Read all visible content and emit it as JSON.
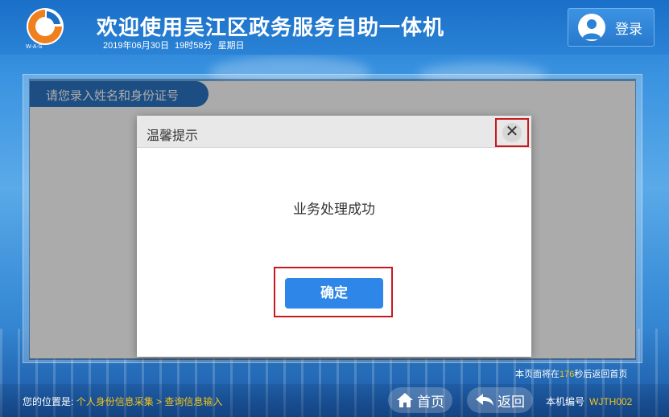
{
  "header": {
    "logo_text": "W-A-S",
    "title": "欢迎使用吴江区政务服务自助一体机",
    "date": "2019年06月30日",
    "time": "19时58分",
    "weekday": "星期日",
    "login_label": "登录",
    "login_icon": "user-avatar-icon"
  },
  "panel": {
    "tab_label": "请您录入姓名和身份证号"
  },
  "dialog": {
    "title": "温馨提示",
    "close_icon": "close-icon",
    "message": "业务处理成功",
    "confirm_label": "确定"
  },
  "footer": {
    "countdown_prefix": "本页面将在",
    "countdown_seconds": "176",
    "countdown_suffix": "秒后返回首页",
    "location_label": "您的位置是:",
    "location_path": "个人身份信息采集 > 查询信息输入",
    "home_label": "首页",
    "home_icon": "home-icon",
    "back_label": "返回",
    "back_icon": "back-arrow-icon",
    "machine_label": "本机编号",
    "machine_code": "WJTH002"
  },
  "colors": {
    "header_blue": "#1a6fc8",
    "accent_yellow": "#f5c518",
    "confirm_blue": "#2d86e8",
    "highlight_red": "#c8191f",
    "logo_orange": "#f07f1e"
  }
}
